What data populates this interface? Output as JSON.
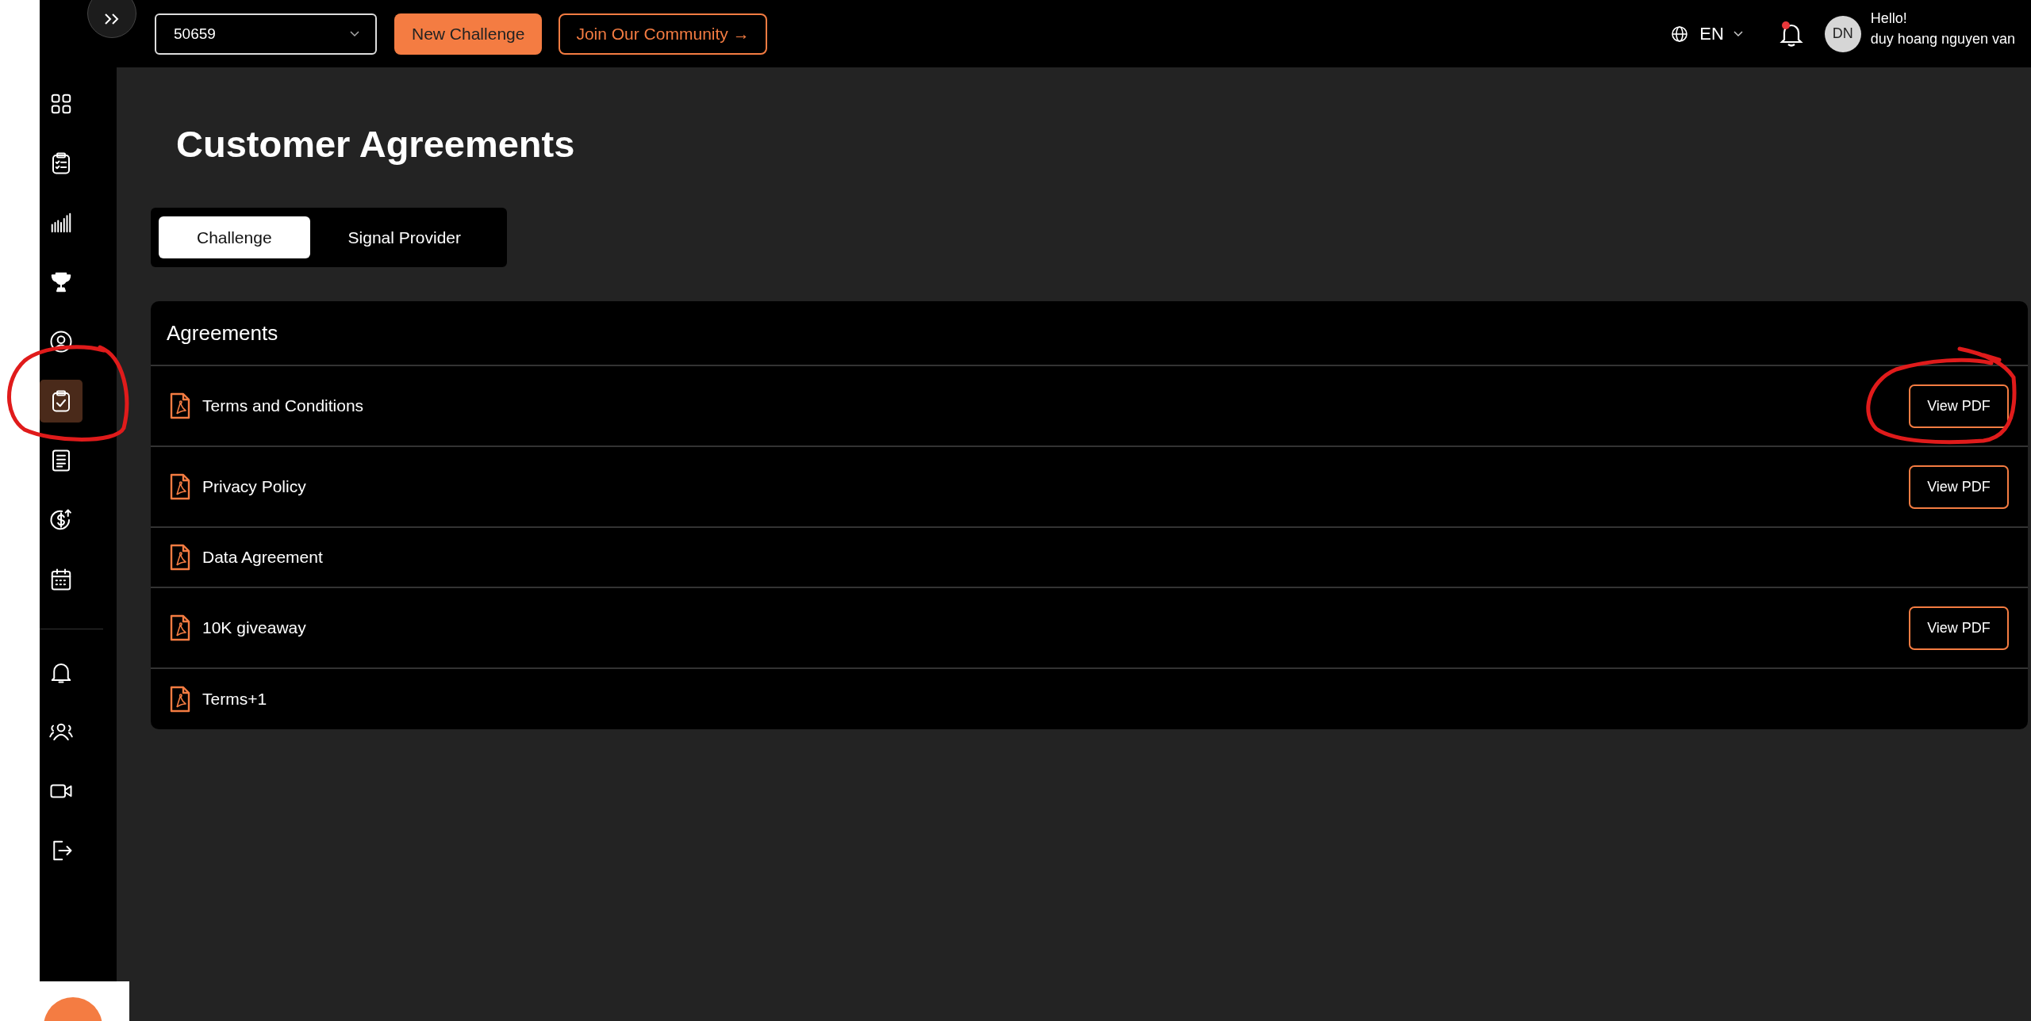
{
  "topbar": {
    "account_select": {
      "value": "50659"
    },
    "new_challenge_button": "New Challenge",
    "community_link": "Join Our Community →",
    "language": "EN",
    "notifications": {
      "unread": true
    },
    "user": {
      "initials": "DN",
      "greeting": "Hello!",
      "name": "duy hoang nguyen van"
    }
  },
  "sidebar": {
    "main_items": [
      {
        "selected": false
      },
      {
        "selected": false
      },
      {
        "selected": false
      },
      {
        "selected": false
      },
      {
        "selected": false
      },
      {
        "selected": true
      },
      {
        "selected": false
      },
      {
        "selected": false
      },
      {
        "selected": false
      }
    ],
    "secondary_items": [
      {
        "selected": false
      },
      {
        "selected": false
      },
      {
        "selected": false
      },
      {
        "selected": false
      }
    ]
  },
  "page": {
    "title": "Customer Agreements",
    "tabs": [
      {
        "label": "Challenge",
        "selected": true
      },
      {
        "label": "Signal Provider",
        "selected": false
      }
    ],
    "agreements": {
      "heading": "Agreements",
      "rows": [
        {
          "title": "Terms and Conditions",
          "action": "View PDF"
        },
        {
          "title": "Privacy Policy",
          "action": "View PDF"
        },
        {
          "title": "Data Agreement"
        },
        {
          "title": "10K giveaway",
          "action": "View PDF"
        },
        {
          "title": "Terms+1"
        }
      ]
    }
  }
}
